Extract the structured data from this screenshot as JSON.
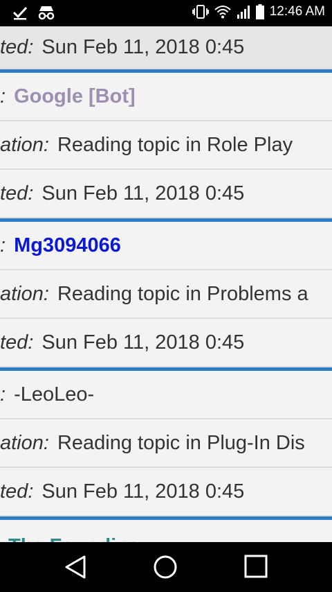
{
  "status_bar": {
    "time": "12:46 AM",
    "left_icons": [
      "check-download-icon",
      "incognito-icon"
    ],
    "right_icons": [
      "vibrate-icon",
      "wifi-icon",
      "signal-icon",
      "battery-icon"
    ]
  },
  "first_entry": {
    "label": "ted:",
    "value": "Sun Feb 11, 2018 0:45"
  },
  "entries": [
    {
      "user_label": ":",
      "user": "Google [Bot]",
      "location_label": "ation:",
      "location": "Reading topic in Role Play",
      "time_label": "ted:",
      "time": "Sun Feb 11, 2018 0:45"
    },
    {
      "user_label": ":",
      "user": "Mg3094066",
      "location_label": "ation:",
      "location": "Reading topic in Problems a",
      "time_label": "ted:",
      "time": "Sun Feb 11, 2018 0:45"
    },
    {
      "user_label": ":",
      "user": "-LeoLeo-",
      "location_label": "ation:",
      "location": "Reading topic in Plug-In Dis",
      "time_label": "ted:",
      "time": "Sun Feb 11, 2018 0:45"
    }
  ],
  "partial_entry": {
    "user": "The Founding"
  },
  "colors": {
    "separator": "#2b7bc6",
    "bot": "#9e8fb0",
    "registered": "#0a19d6",
    "team": "#2f8a8a"
  },
  "nav_buttons": [
    "back-icon",
    "home-icon",
    "recents-icon"
  ]
}
